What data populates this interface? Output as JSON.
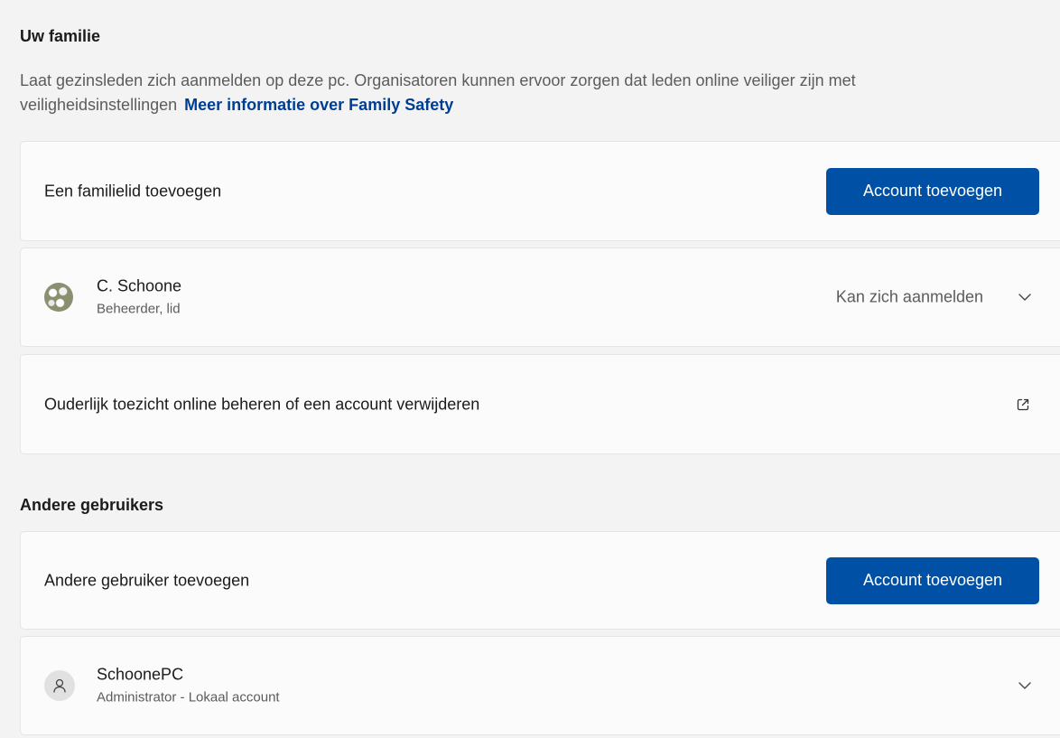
{
  "family": {
    "title": "Uw familie",
    "description": "Laat gezinsleden zich aanmelden op deze pc. Organisatoren kunnen ervoor zorgen dat leden online veiliger zijn met veiligheidsinstellingen",
    "link": "Meer informatie over Family Safety",
    "add": {
      "label": "Een familielid toevoegen",
      "button": "Account toevoegen"
    },
    "member": {
      "name": "C. Schoone",
      "role": "Beheerder, lid",
      "status": "Kan zich aanmelden",
      "avatar_icon": "photo-avatar",
      "expand_icon": "chevron-down-icon"
    },
    "manage": {
      "label": "Ouderlijk toezicht online beheren of een account verwijderen",
      "icon": "external-link-icon"
    }
  },
  "others": {
    "title": "Andere gebruikers",
    "add": {
      "label": "Andere gebruiker toevoegen",
      "button": "Account toevoegen"
    },
    "user": {
      "name": "SchoonePC",
      "role": "Administrator - Lokaal account",
      "avatar_icon": "person-icon",
      "expand_icon": "chevron-down-icon"
    }
  },
  "colors": {
    "accent": "#0050a5",
    "link": "#003e92",
    "background": "#f3f3f3",
    "card": "#fbfbfb"
  }
}
